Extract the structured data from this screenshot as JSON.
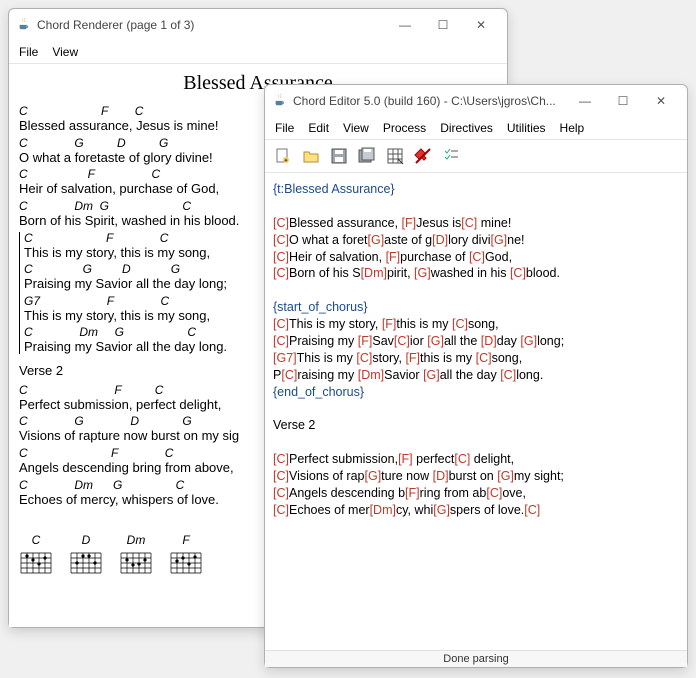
{
  "renderer": {
    "title": "Chord Renderer (page 1 of 3)",
    "menus": [
      "File",
      "View"
    ],
    "song_title": "Blessed Assurance",
    "verse1": [
      {
        "chords": "C                      F        C",
        "lyric": "Blessed assurance, Jesus is mine!"
      },
      {
        "chords": "C              G          D          G",
        "lyric": "O what a foretaste of glory divine!"
      },
      {
        "chords": "C                  F                 C",
        "lyric": "Heir of salvation, purchase of God,"
      },
      {
        "chords": "C              Dm  G                      C",
        "lyric": "Born of his Spirit, washed in his blood."
      }
    ],
    "chorus": [
      {
        "chords": "C                      F              C",
        "lyric": "This is my story, this is my song,"
      },
      {
        "chords": "C               G         D            G",
        "lyric": "Praising my Savior all the day long;"
      },
      {
        "chords": "G7                    F              C",
        "lyric": "This is my story, this is my song,"
      },
      {
        "chords": "C              Dm     G                   C",
        "lyric": "Praising my Savior all the day long."
      }
    ],
    "verse2_label": "Verse 2",
    "verse2": [
      {
        "chords": "C                          F          C",
        "lyric": "Perfect submission, perfect delight,"
      },
      {
        "chords": "C              G              D             G",
        "lyric": "Visions of rapture now burst on my sig"
      },
      {
        "chords": "C                         F              C",
        "lyric": "Angels descending bring from above,"
      },
      {
        "chords": "C              Dm      G                C",
        "lyric": "Echoes of mercy, whispers of love."
      }
    ],
    "diagrams": [
      "C",
      "D",
      "Dm",
      "F"
    ]
  },
  "editor": {
    "title": "Chord Editor 5.0 (build 160) - C:\\Users\\jgros\\Ch...",
    "menus": [
      "File",
      "Edit",
      "View",
      "Process",
      "Directives",
      "Utilities",
      "Help"
    ],
    "lines": [
      {
        "t": "dir",
        "text": "{t:Blessed Assurance}"
      },
      {
        "t": "blank"
      },
      {
        "t": "mix",
        "parts": [
          [
            "c",
            "[C]"
          ],
          [
            "p",
            "Blessed assurance, "
          ],
          [
            "c",
            "[F]"
          ],
          [
            "p",
            "Jesus is"
          ],
          [
            "c",
            "[C]"
          ],
          [
            "p",
            " mine!"
          ]
        ]
      },
      {
        "t": "mix",
        "parts": [
          [
            "c",
            "[C]"
          ],
          [
            "p",
            "O what a foret"
          ],
          [
            "c",
            "[G]"
          ],
          [
            "p",
            "aste of g"
          ],
          [
            "c",
            "[D]"
          ],
          [
            "p",
            "lory divi"
          ],
          [
            "c",
            "[G]"
          ],
          [
            "p",
            "ne!"
          ]
        ]
      },
      {
        "t": "mix",
        "parts": [
          [
            "c",
            "[C]"
          ],
          [
            "p",
            "Heir of salvation, "
          ],
          [
            "c",
            "[F]"
          ],
          [
            "p",
            "purchase of "
          ],
          [
            "c",
            "[C]"
          ],
          [
            "p",
            "God,"
          ]
        ]
      },
      {
        "t": "mix",
        "parts": [
          [
            "c",
            "[C]"
          ],
          [
            "p",
            "Born of his S"
          ],
          [
            "c",
            "[Dm]"
          ],
          [
            "p",
            "pirit, "
          ],
          [
            "c",
            "[G]"
          ],
          [
            "p",
            "washed in his "
          ],
          [
            "c",
            "[C]"
          ],
          [
            "p",
            "blood."
          ]
        ]
      },
      {
        "t": "blank"
      },
      {
        "t": "dir",
        "text": "{start_of_chorus}"
      },
      {
        "t": "mix",
        "parts": [
          [
            "c",
            "[C]"
          ],
          [
            "p",
            "This is my story, "
          ],
          [
            "c",
            "[F]"
          ],
          [
            "p",
            "this is my "
          ],
          [
            "c",
            "[C]"
          ],
          [
            "p",
            "song,"
          ]
        ]
      },
      {
        "t": "mix",
        "parts": [
          [
            "c",
            "[C]"
          ],
          [
            "p",
            "Praising my "
          ],
          [
            "c",
            "[F]"
          ],
          [
            "p",
            "Sav"
          ],
          [
            "c",
            "[C]"
          ],
          [
            "p",
            "ior "
          ],
          [
            "c",
            "[G]"
          ],
          [
            "p",
            "all the "
          ],
          [
            "c",
            "[D]"
          ],
          [
            "p",
            "day "
          ],
          [
            "c",
            "[G]"
          ],
          [
            "p",
            "long;"
          ]
        ]
      },
      {
        "t": "mix",
        "parts": [
          [
            "c",
            "[G7]"
          ],
          [
            "p",
            "This is my "
          ],
          [
            "c",
            "[C]"
          ],
          [
            "p",
            "story, "
          ],
          [
            "c",
            "[F]"
          ],
          [
            "p",
            "this is my "
          ],
          [
            "c",
            "[C]"
          ],
          [
            "p",
            "song,"
          ]
        ]
      },
      {
        "t": "mix",
        "parts": [
          [
            "p",
            "P"
          ],
          [
            "c",
            "[C]"
          ],
          [
            "p",
            "raising my "
          ],
          [
            "c",
            "[Dm]"
          ],
          [
            "p",
            "Savior "
          ],
          [
            "c",
            "[G]"
          ],
          [
            "p",
            "all the day "
          ],
          [
            "c",
            "[C]"
          ],
          [
            "p",
            "long."
          ]
        ]
      },
      {
        "t": "dir",
        "text": "{end_of_chorus}"
      },
      {
        "t": "blank"
      },
      {
        "t": "plain",
        "text": "Verse 2"
      },
      {
        "t": "blank"
      },
      {
        "t": "mix",
        "parts": [
          [
            "c",
            "[C]"
          ],
          [
            "p",
            "Perfect submission,"
          ],
          [
            "c",
            "[F]"
          ],
          [
            "p",
            " perfect"
          ],
          [
            "c",
            "[C]"
          ],
          [
            "p",
            " delight,"
          ]
        ]
      },
      {
        "t": "mix",
        "parts": [
          [
            "c",
            "[C]"
          ],
          [
            "p",
            "Visions of rap"
          ],
          [
            "c",
            "[G]"
          ],
          [
            "p",
            "ture now "
          ],
          [
            "c",
            "[D]"
          ],
          [
            "p",
            "burst on "
          ],
          [
            "c",
            "[G]"
          ],
          [
            "p",
            "my sight;"
          ]
        ]
      },
      {
        "t": "mix",
        "parts": [
          [
            "c",
            "[C]"
          ],
          [
            "p",
            "Angels descending b"
          ],
          [
            "c",
            "[F]"
          ],
          [
            "p",
            "ring from ab"
          ],
          [
            "c",
            "[C]"
          ],
          [
            "p",
            "ove,"
          ]
        ]
      },
      {
        "t": "mix",
        "parts": [
          [
            "c",
            "[C]"
          ],
          [
            "p",
            "Echoes of mer"
          ],
          [
            "c",
            "[Dm]"
          ],
          [
            "p",
            "cy, whi"
          ],
          [
            "c",
            "[G]"
          ],
          [
            "p",
            "spers of love."
          ],
          [
            "c",
            "[C]"
          ]
        ]
      }
    ],
    "status": "Done parsing"
  }
}
